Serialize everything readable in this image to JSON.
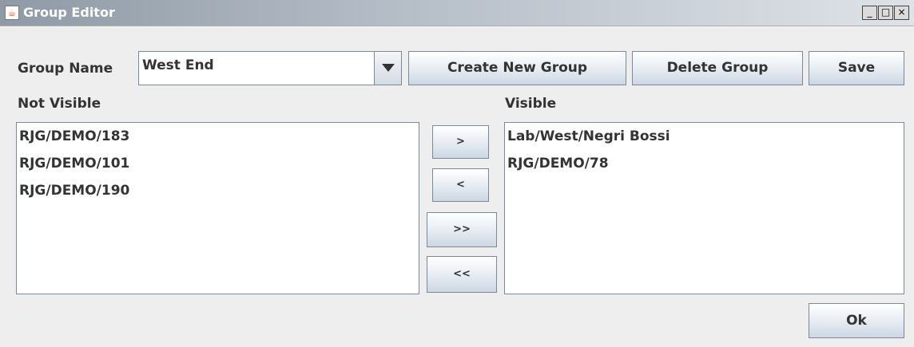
{
  "window": {
    "title": "Group Editor",
    "controls": {
      "minimize": "_",
      "maximize": "□",
      "close": "×"
    }
  },
  "group_name": {
    "label": "Group Name",
    "selected": "West End"
  },
  "toolbar": {
    "create_label": "Create New Group",
    "delete_label": "Delete Group",
    "save_label": "Save"
  },
  "not_visible": {
    "label": "Not Visible",
    "items": [
      "RJG/DEMO/183",
      "RJG/DEMO/101",
      "RJG/DEMO/190"
    ]
  },
  "visible": {
    "label": "Visible",
    "items": [
      "Lab/West/Negri Bossi",
      "RJG/DEMO/78"
    ]
  },
  "transfer": {
    "move_right": ">",
    "move_left": "<",
    "move_all_right": ">>",
    "move_all_left": "<<"
  },
  "ok_label": "Ok",
  "icons": {
    "app": "java-icon",
    "dropdown": "chevron-down-icon"
  }
}
